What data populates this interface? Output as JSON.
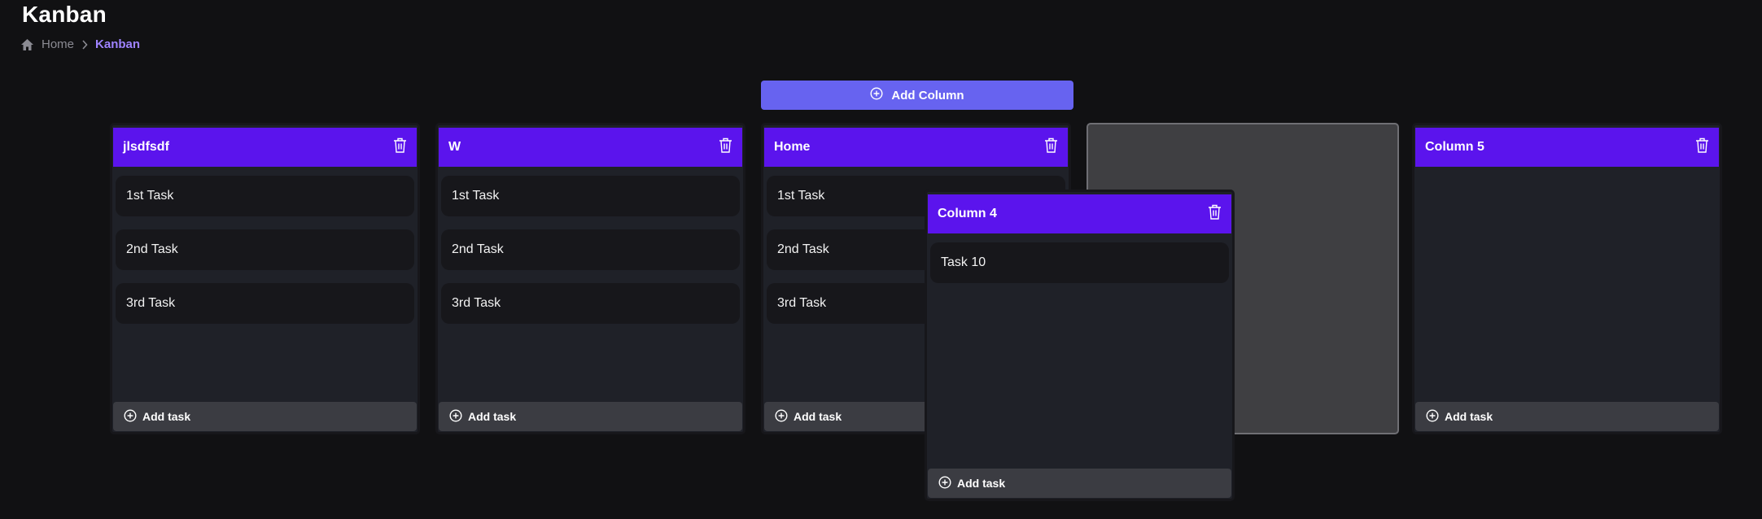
{
  "page": {
    "title": "Kanban"
  },
  "breadcrumb": {
    "home": "Home",
    "current": "Kanban"
  },
  "toolbar": {
    "add_column_label": "Add Column"
  },
  "columns": [
    {
      "title": "jlsdfsdf",
      "tasks": [
        "1st Task",
        "2nd Task",
        "3rd Task"
      ],
      "add_task_label": "Add task"
    },
    {
      "title": "W",
      "tasks": [
        "1st Task",
        "2nd Task",
        "3rd Task"
      ],
      "add_task_label": "Add task"
    },
    {
      "title": "Home",
      "tasks": [
        "1st Task",
        "2nd Task",
        "3rd Task"
      ],
      "add_task_label": "Add task"
    },
    {
      "title": "Column 4",
      "tasks": [
        "Task 10"
      ],
      "add_task_label": "Add task",
      "state": "dragging"
    },
    {
      "title": "Column 5",
      "tasks": [],
      "add_task_label": "Add task"
    }
  ],
  "colors": {
    "background": "#111113",
    "column_header": "#5b14ed",
    "accent_button": "#6763f0",
    "breadcrumb_active": "#9f83ff"
  }
}
